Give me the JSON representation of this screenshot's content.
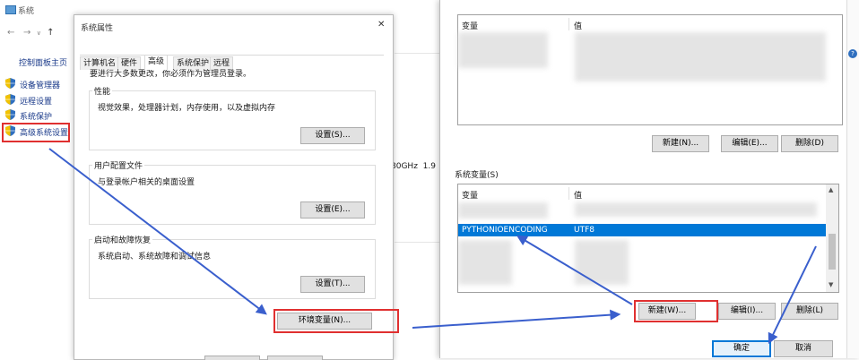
{
  "system_window": {
    "title": "系统",
    "control_panel_home": "控制面板主页",
    "nav_items": [
      {
        "label": "设备管理器"
      },
      {
        "label": "远程设置"
      },
      {
        "label": "系统保护"
      },
      {
        "label": "高级系统设置"
      }
    ],
    "cpu_fragment": "80GHz  1.9"
  },
  "sysprops": {
    "title": "系统属性",
    "close_glyph": "✕",
    "tabs": [
      "计算机名",
      "硬件",
      "高级",
      "系统保护",
      "远程"
    ],
    "admin_note": "要进行大多数更改，你必须作为管理员登录。",
    "performance": {
      "label": "性能",
      "desc": "视觉效果，处理器计划，内存使用，以及虚拟内存",
      "button": "设置(S)..."
    },
    "user_profiles": {
      "label": "用户配置文件",
      "desc": "与登录帐户相关的桌面设置",
      "button": "设置(E)..."
    },
    "startup": {
      "label": "启动和故障恢复",
      "desc": "系统启动、系统故障和调试信息",
      "button": "设置(T)..."
    },
    "env_button": "环境变量(N)..."
  },
  "envvars": {
    "user_table": {
      "col_var": "变量",
      "col_val": "值"
    },
    "user_buttons": {
      "new": "新建(N)...",
      "edit": "编辑(E)...",
      "delete": "删除(D)"
    },
    "sys_label": "系统变量(S)",
    "sys_table": {
      "col_var": "变量",
      "col_val": "值"
    },
    "selected_row": {
      "var": "PYTHONIOENCODING",
      "val": "UTF8"
    },
    "sys_buttons": {
      "new": "新建(W)...",
      "edit": "编辑(I)...",
      "delete": "删除(L)"
    },
    "ok": "确定",
    "cancel": "取消"
  },
  "colors": {
    "highlight": "#e03030",
    "arrow": "#3a5fcd",
    "selection": "#0078d7"
  }
}
